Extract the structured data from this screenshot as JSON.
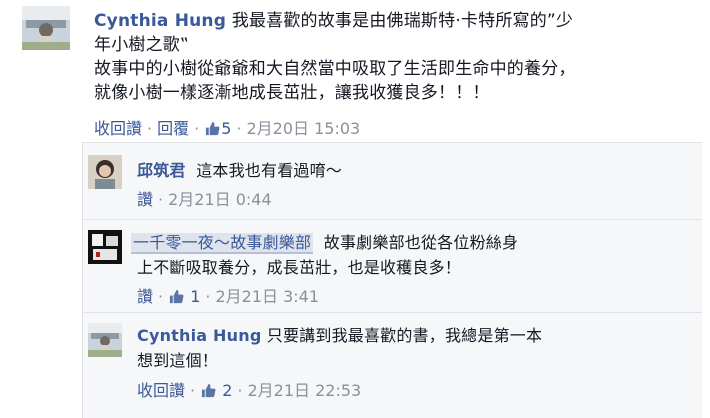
{
  "main_comment": {
    "author": "Cynthia Hung",
    "text_lines": [
      "我最喜歡的故事是由佛瑞斯特·卡特所寫的”少",
      "年小樹之歌‟",
      "故事中的小樹從爺爺和大自然當中吸取了生活即生命中的養分，",
      "就像小樹一樣逐漸地成長茁壯，讓我收獲良多！！！"
    ],
    "actions": {
      "withdraw_like": "收回讚",
      "reply": "回覆",
      "like_count": "5",
      "timestamp": "2月20日 15:03"
    }
  },
  "replies": [
    {
      "author": "邱筑君",
      "text_lines": [
        "這本我也有看過唷～"
      ],
      "actions": {
        "like": "讚",
        "timestamp": "2月21日 0:44"
      }
    },
    {
      "author": "一千零一夜～故事劇樂部",
      "text_lines": [
        "故事劇樂部也從各位粉絲身",
        "上不斷吸取養分，成長茁壯，也是收穫良多！"
      ],
      "actions": {
        "like": "讚",
        "like_count": "1",
        "timestamp": "2月21日 3:41"
      }
    },
    {
      "author": "Cynthia Hung",
      "text_lines": [
        "只要講到我最喜歡的書，我總是第一本",
        "想到這個！"
      ],
      "actions": {
        "withdraw_like": "收回讚",
        "like_count": "2",
        "timestamp": "2月21日 22:53"
      }
    }
  ],
  "separator": "·",
  "icons": {
    "thumb": "thumbs-up-icon"
  },
  "colors": {
    "link": "#3b5998",
    "meta": "#89919c",
    "reply_bg": "#f6f7f9"
  }
}
